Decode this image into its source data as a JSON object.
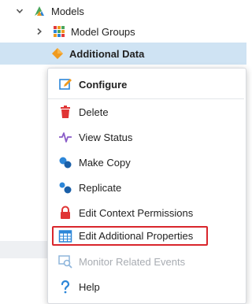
{
  "tree": {
    "models": {
      "label": "Models",
      "icon": "models-icon"
    },
    "model_groups": {
      "label": "Model Groups",
      "icon": "grid-icon"
    },
    "additional_data": {
      "label": "Additional Data",
      "icon": "diamond-icon"
    }
  },
  "context_menu": {
    "items": [
      {
        "label": "Configure",
        "icon": "pencil-icon"
      },
      {
        "label": "Delete",
        "icon": "trash-icon"
      },
      {
        "label": "View Status",
        "icon": "pulse-icon"
      },
      {
        "label": "Make Copy",
        "icon": "copy-icon"
      },
      {
        "label": "Replicate",
        "icon": "replicate-icon"
      },
      {
        "label": "Edit Context Permissions",
        "icon": "lock-icon"
      },
      {
        "label": "Edit Additional Properties",
        "icon": "table-icon"
      },
      {
        "label": "Monitor Related Events",
        "icon": "monitor-search-icon"
      },
      {
        "label": "Help",
        "icon": "help-icon"
      }
    ]
  },
  "colors": {
    "selected_row": "#cfe3f3",
    "highlight_border": "#d9262c",
    "delete_red": "#e03434",
    "accent_blue": "#2c86d8",
    "orange": "#f09a1e"
  }
}
